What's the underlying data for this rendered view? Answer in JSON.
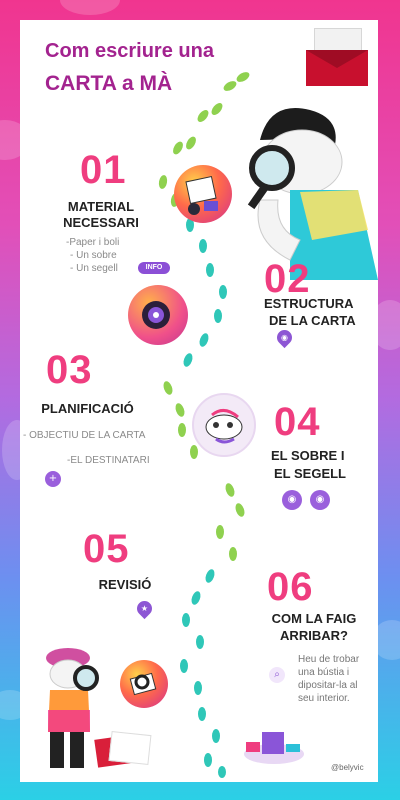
{
  "title": {
    "line1": "Com escriure una",
    "line2": "CARTA a MÀ"
  },
  "steps": [
    {
      "number": "01",
      "heading_line1": "MATERIAL",
      "heading_line2": "NECESSARI",
      "items": [
        "-Paper i boli",
        "- Un sobre",
        "- Un segell"
      ],
      "badge": "INFO"
    },
    {
      "number": "02",
      "heading_line1": "ESTRUCTURA",
      "heading_line2": "DE LA CARTA",
      "icon": "eye-icon"
    },
    {
      "number": "03",
      "heading": "PLANIFICACIÓ",
      "items": [
        "- OBJECTIU DE LA CARTA",
        "-EL DESTINATARI"
      ],
      "icon": "plus-icon"
    },
    {
      "number": "04",
      "heading_line1": "EL SOBRE I",
      "heading_line2": "EL SEGELL",
      "icons": [
        "eye-icon",
        "eye-icon"
      ]
    },
    {
      "number": "05",
      "heading": "REVISIÓ",
      "icon": "star-icon"
    },
    {
      "number": "06",
      "heading_line1": "COM LA FAIG",
      "heading_line2": "ARRIBAR?",
      "desc": [
        "Heu de trobar",
        "una bústia i",
        "dipositar-la al",
        "seu interior."
      ],
      "icon": "search-icon"
    }
  ],
  "credit": "@belyvic",
  "colors": {
    "number": "#ef3d7f",
    "title": "#a3238f",
    "icon_bg": "#9a5fdc",
    "footprint_green": "#8fd14f",
    "footprint_teal": "#2fc7b8"
  }
}
